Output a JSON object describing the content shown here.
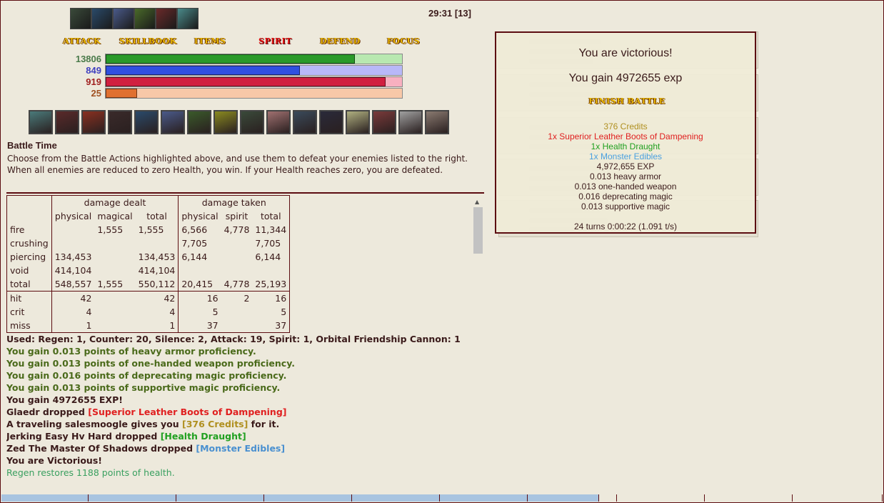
{
  "timer": "29:31 [13]",
  "effects": [
    {
      "name": "effect-1",
      "color": "#3a4a3a"
    },
    {
      "name": "effect-2",
      "color": "#2a4a6a"
    },
    {
      "name": "effect-3",
      "color": "#4a5a8a"
    },
    {
      "name": "effect-4",
      "color": "#4a6a2a"
    },
    {
      "name": "effect-5",
      "color": "#6a2a2a"
    },
    {
      "name": "effect-6",
      "color": "#4a8a8a"
    }
  ],
  "menu": {
    "attack": "ATTACK",
    "skillbook": "SKILLBOOK",
    "items": "ITEMS",
    "spirit": "SPIRIT",
    "defend": "DEFEND",
    "focus": "FOCUS"
  },
  "bars": {
    "health": {
      "value": "13806",
      "fraction": 0.84,
      "color": "#2a9a2a",
      "bg": "#b8e8b0",
      "label_color": "#4a7a4a"
    },
    "magic": {
      "value": "849",
      "fraction": 0.655,
      "color": "#3050e0",
      "bg": "#b8b8f8",
      "label_color": "#4040c0"
    },
    "spirit": {
      "value": "919",
      "fraction": 0.945,
      "color": "#d02040",
      "bg": "#f8b0c0",
      "label_color": "#a02020"
    },
    "overcharge": {
      "value": "25",
      "fraction": 0.105,
      "color": "#e07030",
      "bg": "#f8c8a8",
      "label_color": "#a05020"
    }
  },
  "skills": [
    {
      "name": "skill-1",
      "color": "#4a7a7a"
    },
    {
      "name": "skill-2",
      "color": "#5a2a2a"
    },
    {
      "name": "skill-3",
      "color": "#8a3020"
    },
    {
      "name": "skill-4",
      "color": "#3a2a2a"
    },
    {
      "name": "skill-5",
      "color": "#2a4a6a"
    },
    {
      "name": "skill-6",
      "color": "#4a5a8a"
    },
    {
      "name": "skill-7",
      "color": "#3a5a2a"
    },
    {
      "name": "skill-8",
      "color": "#8a8a20"
    },
    {
      "name": "skill-9",
      "color": "#3a4a3a"
    },
    {
      "name": "skill-10",
      "color": "#a07070"
    },
    {
      "name": "skill-11",
      "color": "#3a4a5a"
    },
    {
      "name": "skill-12",
      "color": "#2a2a3a"
    },
    {
      "name": "skill-13",
      "color": "#b0b080"
    },
    {
      "name": "skill-14",
      "color": "#7a3a3a"
    },
    {
      "name": "skill-15",
      "color": "#a0a0a0"
    },
    {
      "name": "skill-16",
      "color": "#8a7a70"
    }
  ],
  "battle": {
    "title": "Battle Time",
    "description": "Choose from the Battle Actions highlighted above, and use them to defeat your enemies listed to the right. When all enemies are reduced to zero Health, you win. If your Health reaches zero, you are defeated."
  },
  "stats": {
    "group_dealt": "damage dealt",
    "group_taken": "damage taken",
    "headers": [
      "physical",
      "magical",
      "total",
      "physical",
      "spirit",
      "total"
    ],
    "rows": [
      {
        "label": "fire",
        "cells": [
          "",
          "1,555",
          "1,555",
          "6,566",
          "4,778",
          "11,344"
        ]
      },
      {
        "label": "crushing",
        "cells": [
          "",
          "",
          "",
          "7,705",
          "",
          "7,705"
        ]
      },
      {
        "label": "piercing",
        "cells": [
          "134,453",
          "",
          "134,453",
          "6,144",
          "",
          "6,144"
        ]
      },
      {
        "label": "void",
        "cells": [
          "414,104",
          "",
          "414,104",
          "",
          "",
          ""
        ]
      },
      {
        "label": "total",
        "cells": [
          "548,557",
          "1,555",
          "550,112",
          "20,415",
          "4,778",
          "25,193"
        ]
      }
    ],
    "hits": [
      {
        "label": "hit",
        "cells": [
          "42",
          "",
          "42",
          "16",
          "2",
          "16"
        ]
      },
      {
        "label": "crit",
        "cells": [
          "4",
          "",
          "4",
          "5",
          "",
          "5"
        ]
      },
      {
        "label": "miss",
        "cells": [
          "1",
          "",
          "1",
          "37",
          "",
          "37"
        ]
      }
    ]
  },
  "log": {
    "used": "Used: Regen: 1, Counter: 20, Silence: 2, Attack: 19, Spirit: 1, Orbital Friendship Cannon: 1",
    "prof1": "You gain 0.013 points of heavy armor proficiency.",
    "prof2": "You gain 0.013 points of one-handed weapon proficiency.",
    "prof3": "You gain 0.016 points of deprecating magic proficiency.",
    "prof4": "You gain 0.013 points of supportive magic proficiency.",
    "exp": "You gain 4972655 EXP!",
    "drop1_who": "Glaedr dropped ",
    "drop1_item": "[Superior Leather Boots of Dampening]",
    "sales_a": "A traveling salesmoogle gives you ",
    "sales_item": "[376 Credits]",
    "sales_b": " for it.",
    "drop2_who": "Jerking Easy Hv Hard dropped ",
    "drop2_item": "[Health Draught]",
    "drop3_who": "Zed The Master Of Shadows dropped ",
    "drop3_item": "[Monster Edibles]",
    "victorious": "You are Victorious!",
    "regen": "Regen restores 1188 points of health."
  },
  "victory": {
    "title": "You are victorious!",
    "exp": "You gain 4972655 exp",
    "finish_label": "FINISH BATTLE",
    "loot": [
      {
        "text": "376 Credits",
        "color": "#b09020"
      },
      {
        "text": "1x Superior Leather Boots of Dampening",
        "color": "#e02020"
      },
      {
        "text": "1x Health Draught",
        "color": "#20a020"
      },
      {
        "text": "1x Monster Edibles",
        "color": "#4aa0e0"
      },
      {
        "text": "4,972,655 EXP",
        "color": "#3a1a1a"
      },
      {
        "text": "0.013 heavy armor",
        "color": "#3a1a1a"
      },
      {
        "text": "0.013 one-handed weapon",
        "color": "#3a1a1a"
      },
      {
        "text": "0.016 deprecating magic",
        "color": "#3a1a1a"
      },
      {
        "text": "0.013 supportive magic",
        "color": "#3a1a1a"
      }
    ],
    "turns": "24 turns 0:00:22 (1.091 t/s)"
  },
  "colors": {
    "accent": "#5c0d11",
    "background": "#ede9dc"
  }
}
